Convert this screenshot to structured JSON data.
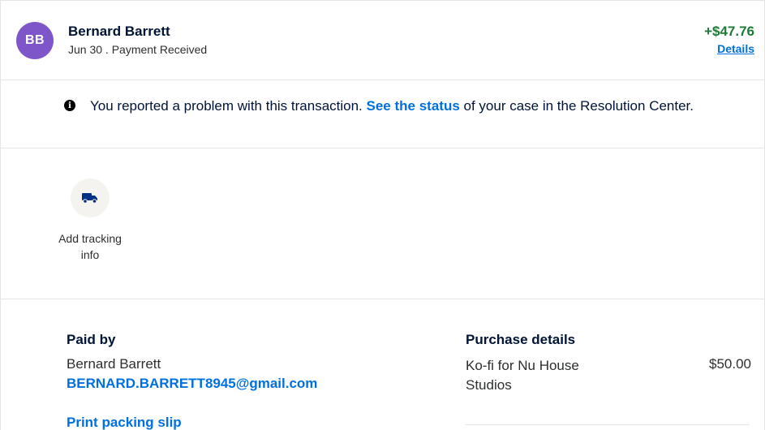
{
  "transaction": {
    "avatar_initials": "BB",
    "name": "Bernard Barrett",
    "subline": "Jun 30 . Payment Received",
    "amount": "+$47.76",
    "details_label": "Details"
  },
  "notice": {
    "text_before": "You reported a problem with this transaction. ",
    "link_label": "See the status",
    "text_after": " of your case in the Resolution Center."
  },
  "tracking": {
    "label": "Add tracking info",
    "icon": "truck-icon"
  },
  "paid_by": {
    "title": "Paid by",
    "name": "Bernard Barrett",
    "email": "BERNARD.BARRETT8945@gmail.com",
    "print_label": "Print packing slip"
  },
  "purchase_details": {
    "title": "Purchase details",
    "item_name": "Ko-fi for Nu House Studios",
    "item_price": "$50.00"
  },
  "colors": {
    "avatar": "#7f56c9",
    "amount": "#1e7a34",
    "link": "#0070e0"
  }
}
